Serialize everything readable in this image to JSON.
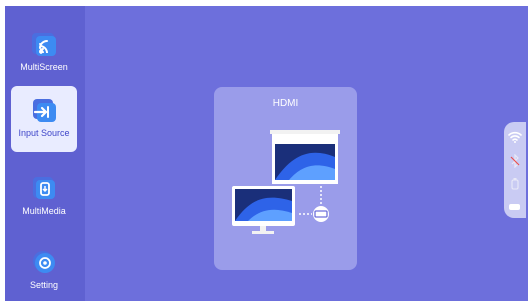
{
  "sidebar": {
    "items": [
      {
        "label": "MultiScreen",
        "icon": "cast-icon"
      },
      {
        "label": "Input Source",
        "icon": "input-source-icon"
      },
      {
        "label": "MultiMedia",
        "icon": "usb-icon"
      },
      {
        "label": "Setting",
        "icon": "gear-icon"
      }
    ],
    "active_index": 1
  },
  "source_card": {
    "title": "HDMI"
  },
  "status": {
    "icons": [
      "wifi-icon",
      "bluetooth-icon",
      "usb-disconnected-icon",
      "battery-icon"
    ]
  },
  "colors": {
    "background": "#6d6fdc",
    "sidebar": "#5f61d1",
    "active_item": "#e9ecff",
    "card": "#9a9cea"
  }
}
